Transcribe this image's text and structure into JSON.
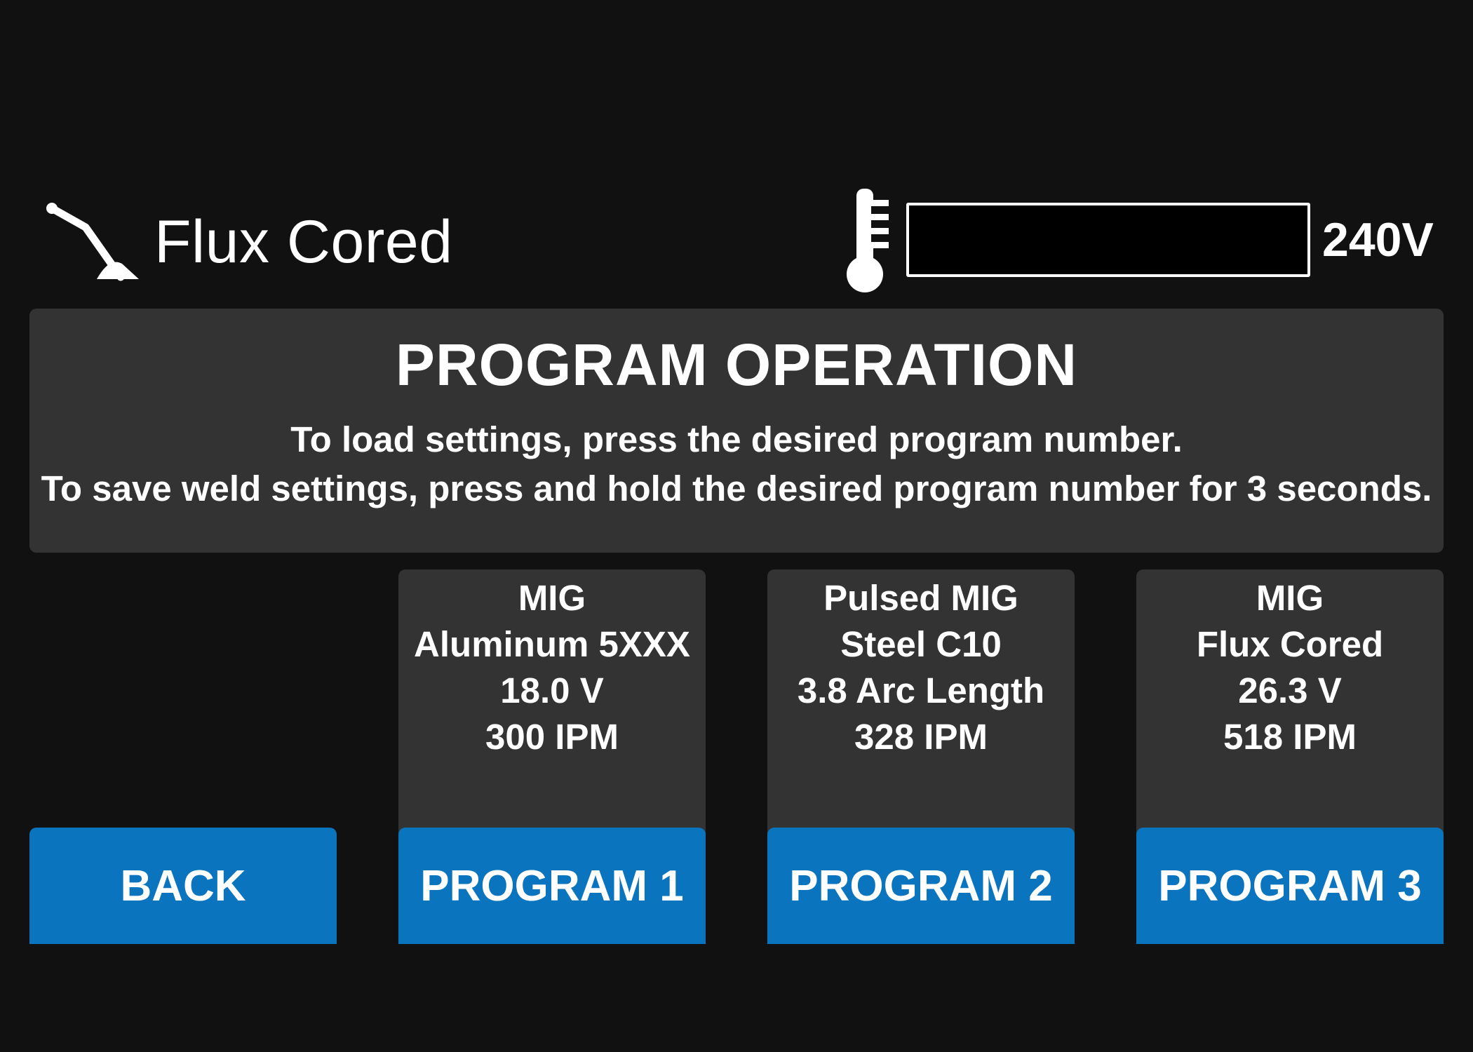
{
  "header": {
    "mode_icon": "welding-torch-icon",
    "mode_label": "Flux Cored",
    "thermal_icon": "thermometer-icon",
    "thermal_level": 0,
    "voltage": "240V"
  },
  "info": {
    "title": "PROGRAM OPERATION",
    "line1": "To load settings, press the desired program number.",
    "line2": "To save weld settings, press and hold the desired program number for 3 seconds."
  },
  "back_button": {
    "label": "BACK"
  },
  "programs": [
    {
      "details": [
        "MIG",
        "Aluminum 5XXX",
        "18.0 V",
        "300 IPM"
      ],
      "button_label": "PROGRAM 1"
    },
    {
      "details": [
        "Pulsed MIG",
        "Steel C10",
        "3.8 Arc Length",
        "328 IPM"
      ],
      "button_label": "PROGRAM 2"
    },
    {
      "details": [
        "MIG",
        "Flux Cored",
        "26.3 V",
        "518 IPM"
      ],
      "button_label": "PROGRAM 3"
    }
  ],
  "colors": {
    "background": "#111111",
    "panel": "#333333",
    "accent": "#0a75be",
    "text": "#ffffff"
  }
}
